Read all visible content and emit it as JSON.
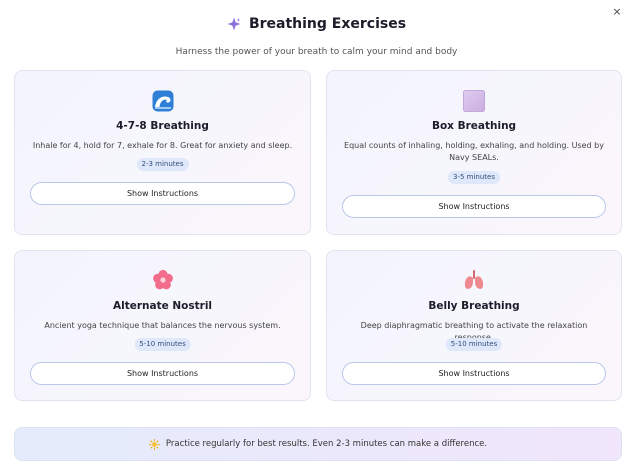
{
  "window": {
    "close_glyph": "×"
  },
  "header": {
    "title": "Breathing Exercises",
    "icon": "sparkle-icon",
    "subtitle": "Harness the power of your breath to calm your mind and body"
  },
  "colors": {
    "card_border": "#e1e4ef",
    "badge_bg": "#dfe7fa",
    "button_border": "#b9c7ea",
    "accent_purple": "#8a6fd8"
  },
  "cards": [
    {
      "title": "4-7-8 Breathing",
      "icon": "wave-icon",
      "description": "Inhale for 4, hold for 7, exhale for 8. Great for anxiety and sleep.",
      "duration": "2-3 minutes",
      "button_label": "Show Instructions"
    },
    {
      "title": "Box Breathing",
      "icon": "square-icon",
      "description": "Equal counts of inhaling, holding, exhaling, and holding. Used by Navy SEALs.",
      "duration": "3-5 minutes",
      "button_label": "Show Instructions"
    },
    {
      "title": "Alternate Nostril",
      "icon": "flower-icon",
      "description": "Ancient yoga technique that balances the nervous system.",
      "duration": "5-10 minutes",
      "button_label": "Show Instructions"
    },
    {
      "title": "Belly Breathing",
      "icon": "lungs-icon",
      "description": "Deep diaphragmatic breathing to activate the relaxation response.",
      "duration": "5-10 minutes",
      "button_label": "Show Instructions"
    }
  ],
  "tip": {
    "icon": "sun-icon",
    "text": "Practice regularly for best results. Even 2-3 minutes can make a difference."
  }
}
